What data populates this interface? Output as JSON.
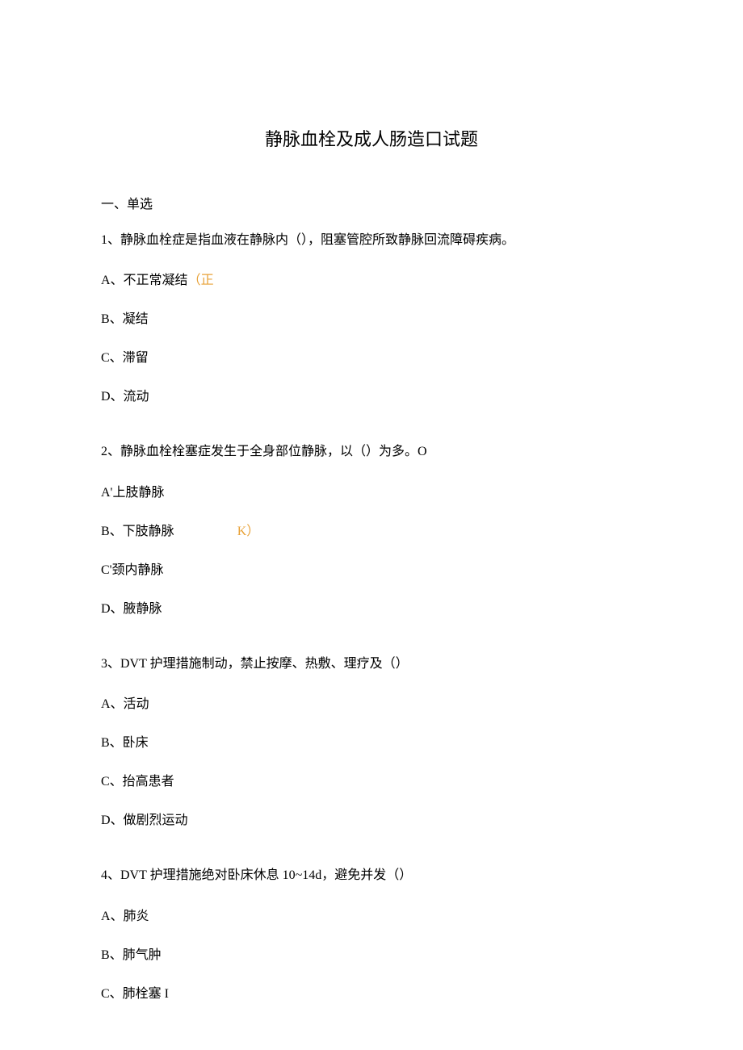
{
  "title": "静脉血栓及成人肠造口试题",
  "section_heading": "一、单选",
  "questions": [
    {
      "stem": "1、静脉血栓症是指血液在静脉内（），阻塞管腔所致静脉回流障碍疾病。",
      "options": [
        {
          "label": "A、不正常凝结",
          "answer": "（正"
        },
        {
          "label": "B、凝结",
          "answer": ""
        },
        {
          "label": "C、滞留",
          "answer": ""
        },
        {
          "label": "D、流动",
          "answer": ""
        }
      ]
    },
    {
      "stem": "2、静脉血栓栓塞症发生于全身部位静脉，以（）为多。O",
      "options": [
        {
          "label": "A'上肢静脉",
          "answer": ""
        },
        {
          "label": "B、下肢静脉",
          "answer": "K）"
        },
        {
          "label": "C'颈内静脉",
          "answer": ""
        },
        {
          "label": "D、腋静脉",
          "answer": ""
        }
      ]
    },
    {
      "stem": "3、DVT 护理措施制动，禁止按摩、热敷、理疗及（）",
      "options": [
        {
          "label": "A、活动",
          "answer": ""
        },
        {
          "label": "B、卧床",
          "answer": ""
        },
        {
          "label": "C、抬高患者",
          "answer": ""
        },
        {
          "label": "D、做剧烈运动",
          "answer": ""
        }
      ]
    },
    {
      "stem": "4、DVT 护理措施绝对卧床休息 10~14d，避免并发（）",
      "options": [
        {
          "label": "A、肺炎",
          "answer": ""
        },
        {
          "label": "B、肺气肿",
          "answer": ""
        },
        {
          "label": "C、肺栓塞 I",
          "answer": ""
        }
      ]
    }
  ]
}
